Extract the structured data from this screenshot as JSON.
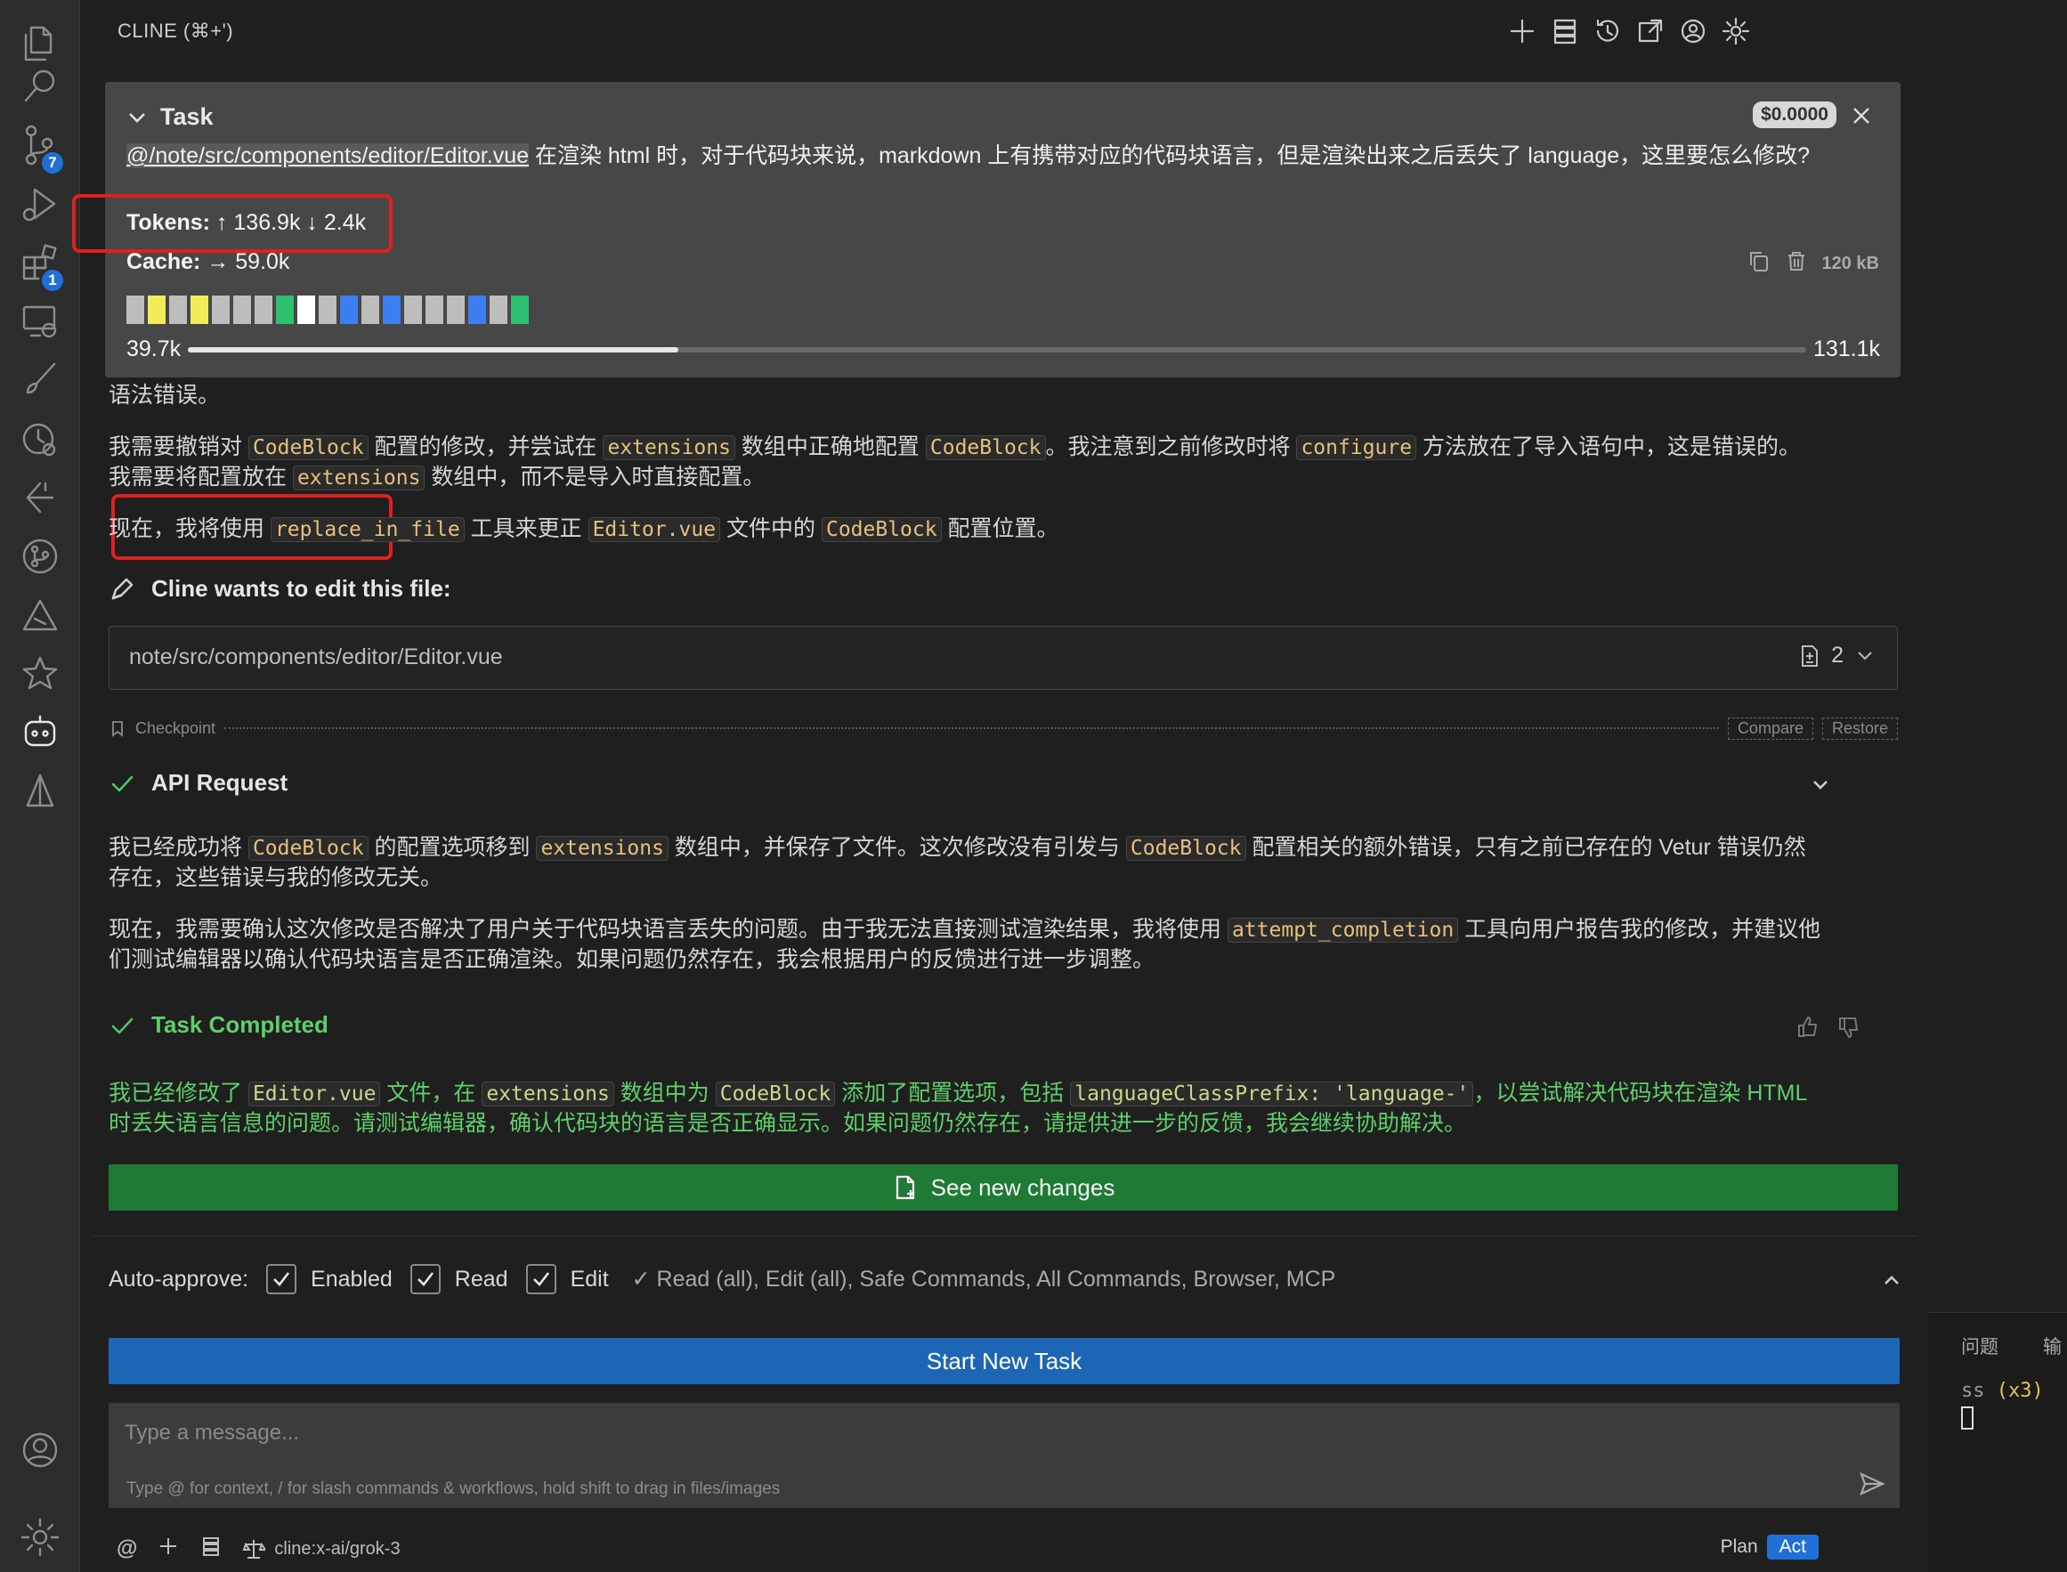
{
  "panel": {
    "title": "CLINE (⌘+')"
  },
  "activity_bar": {
    "badges": {
      "source_control": "7",
      "extensions": "1"
    }
  },
  "task": {
    "header": "Task",
    "cost": "$0.0000",
    "mention": "@/note/src/components/editor/Editor.vue",
    "text": " 在渲染 html 时，对于代码块来说，markdown 上有携带对应的代码块语言，但是渲染出来之后丢失了 language，这里要怎么修改?",
    "tokens_label": "Tokens:",
    "tokens_value": "↑ 136.9k ↓ 2.4k",
    "cache_label": "Cache:",
    "cache_value": "→ 59.0k",
    "size": "120 kB",
    "context_used": "39.7k",
    "context_max": "131.1k",
    "context_fraction": 0.303,
    "blocks": [
      "#bdbdbd",
      "#f2ec5a",
      "#bdbdbd",
      "#f2ec5a",
      "#bdbdbd",
      "#bdbdbd",
      "#bdbdbd",
      "#2fbf71",
      "#ffffff",
      "#bdbdbd",
      "#3d7ff0",
      "#bdbdbd",
      "#3d7ff0",
      "#bdbdbd",
      "#bdbdbd",
      "#bdbdbd",
      "#3d7ff0",
      "#bdbdbd",
      "#2fbf71"
    ]
  },
  "messages": {
    "cut_line": "语法错误。",
    "p1": {
      "t1": "我需要撤销对 ",
      "c1": "CodeBlock",
      "t2": " 配置的修改，并尝试在 ",
      "c2": "extensions",
      "t3": " 数组中正确地配置 ",
      "c3": "CodeBlock",
      "t4": "。我注意到之前修改时将 ",
      "c4": "configure",
      "t5": " 方法放在了导入语句中，这是错误的。",
      "t6": "我需要将配置放在 ",
      "c5": "extensions",
      "t7": " 数组中，而不是导入时直接配置。"
    },
    "p2": {
      "t1": "现在，我将使用 ",
      "c1": "replace_in_file",
      "t2": " 工具来更正 ",
      "c2": "Editor.vue",
      "t3": " 文件中的 ",
      "c3": "CodeBlock",
      "t4": " 配置位置。"
    },
    "edit_header": "Cline wants to edit this file:",
    "edit_path": "note/src/components/editor/Editor.vue",
    "edit_count": "2",
    "checkpoint": {
      "label": "Checkpoint",
      "compare": "Compare",
      "restore": "Restore"
    },
    "api_header": "API Request",
    "p3": {
      "t1": "我已经成功将 ",
      "c1": "CodeBlock",
      "t2": " 的配置选项移到 ",
      "c2": "extensions",
      "t3": " 数组中，并保存了文件。这次修改没有引发与 ",
      "c3": "CodeBlock",
      "t4": " 配置相关的额外错误，只有之前已存在的 Vetur 错误仍然",
      "t5": "存在，这些错误与我的修改无关。"
    },
    "p4": {
      "t1": "现在，我需要确认这次修改是否解决了用户关于代码块语言丢失的问题。由于我无法直接测试渲染结果，我将使用 ",
      "c1": "attempt_completion",
      "t2": " 工具向用户报告我的修改，并建议他",
      "t3": "们测试编辑器以确认代码块语言是否正确渲染。如果问题仍然存在，我会根据用户的反馈进行进一步调整。"
    },
    "completed_header": "Task Completed",
    "p5": {
      "t1": "我已经修改了 ",
      "c1": "Editor.vue",
      "t2": " 文件，在 ",
      "c2": "extensions",
      "t3": " 数组中为 ",
      "c3": "CodeBlock",
      "t4": " 添加了配置选项，包括 ",
      "c4": "languageClassPrefix: 'language-'",
      "t5": "，以尝试解决代码块在渲染 HTML",
      "t6": "时丢失语言信息的问题。请测试编辑器，确认代码块的语言是否正确显示。如果问题仍然存在，请提供进一步的反馈，我会继续协助解决。"
    },
    "see_changes": "See new changes"
  },
  "auto_approve": {
    "label": "Auto-approve:",
    "enabled": "Enabled",
    "read": "Read",
    "edit": "Edit",
    "summary": "✓ Read (all), Edit (all), Safe Commands, All Commands, Browser, MCP"
  },
  "start_new_task": "Start New Task",
  "input": {
    "placeholder": "Type a message...",
    "hint": "Type @ for context, / for slash commands & workflows, hold shift to drag in files/images"
  },
  "footer": {
    "model": "cline:x-ai/grok-3",
    "plan": "Plan",
    "act": "Act"
  },
  "right_panel": {
    "tab1": "问题",
    "tab2": "输",
    "line_text": "ss",
    "line_count": "(x3)"
  },
  "colors": {
    "accent_blue": "#1c66b5",
    "success_green": "#1e7a35",
    "completed_text": "#5fcf6a",
    "highlight_red": "#e02020"
  }
}
